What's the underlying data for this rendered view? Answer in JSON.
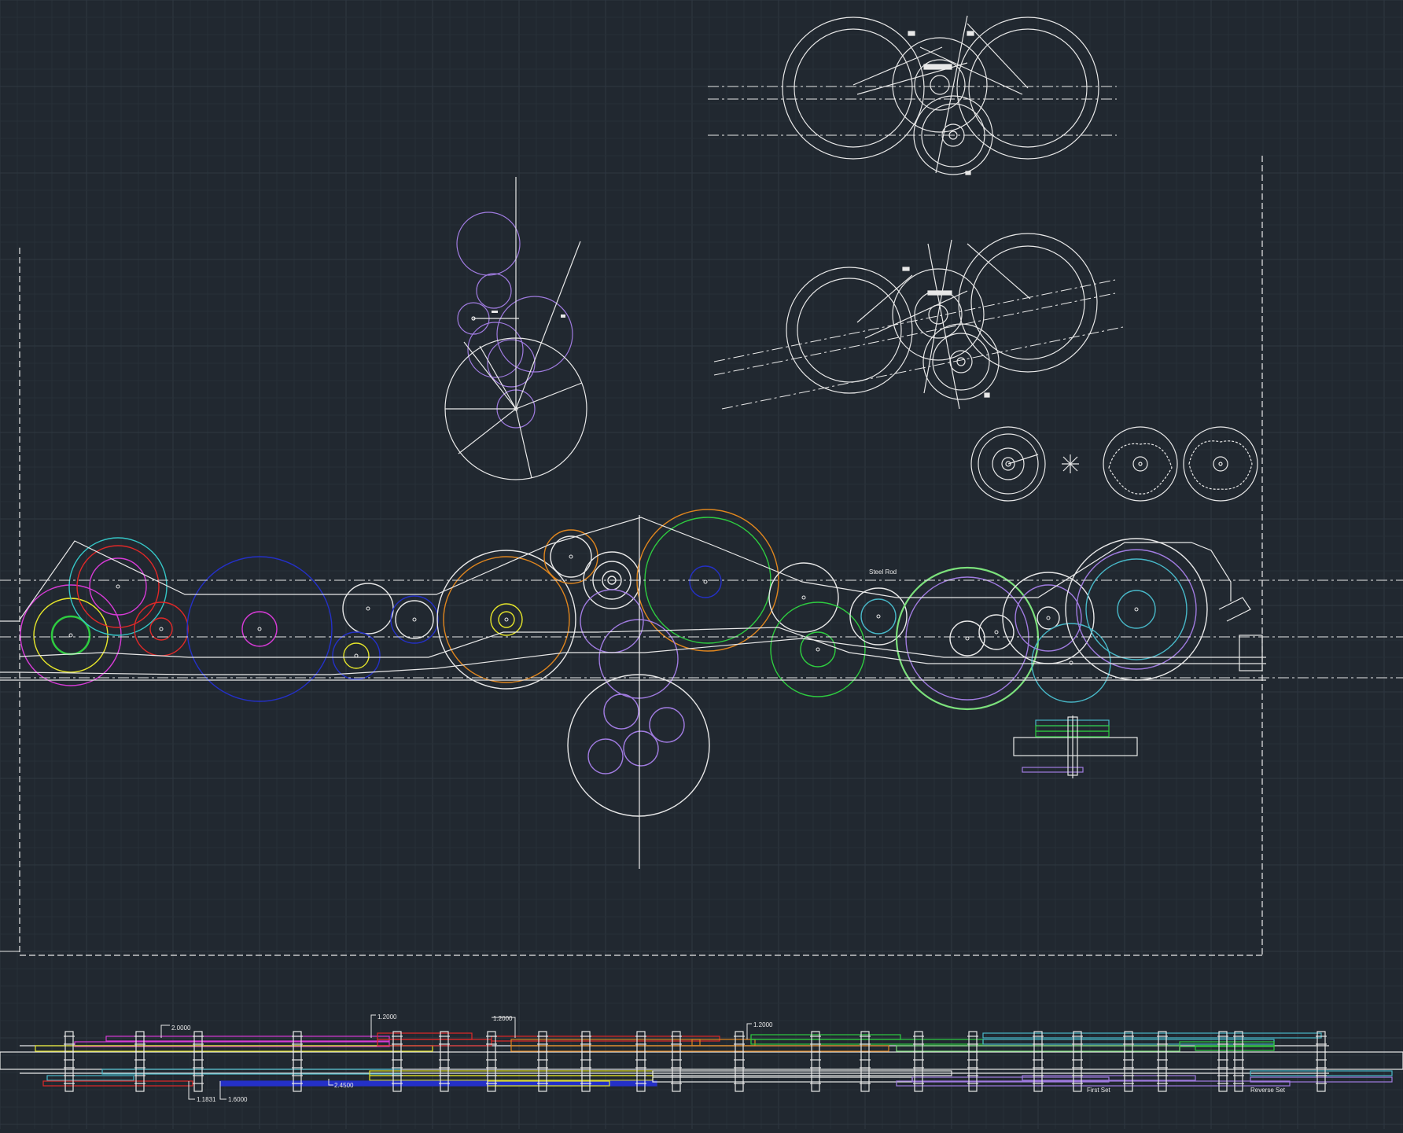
{
  "canvas": {
    "background": "#212830",
    "grid_minor": "#283038",
    "grid_major": "#2e3741",
    "line_color": "#e8e8e8"
  },
  "colors": {
    "white": "#e8e8e8",
    "purple": "#a07be0",
    "magenta": "#d63bd6",
    "red": "#e02828",
    "cyan": "#35c6c6",
    "yellow": "#e6e62a",
    "green": "#2ecc40",
    "lightgreen": "#7be07b",
    "orange": "#e0861e",
    "blue": "#2430c8",
    "teal": "#48b8c8"
  },
  "labels": {
    "steel_rod": "Steel Rod",
    "first_set": "First Set",
    "reverse_set": "Reverse Set"
  },
  "dimensions": {
    "d_2_0000": "2.0000",
    "d_1_2000_a": "1.2000",
    "d_1_2000_b": "1.2000",
    "d_1_2000_c": "1.2000",
    "d_1_1831": "1.1831",
    "d_1_6000": "1.6000",
    "d_2_4500": "2.4500"
  }
}
